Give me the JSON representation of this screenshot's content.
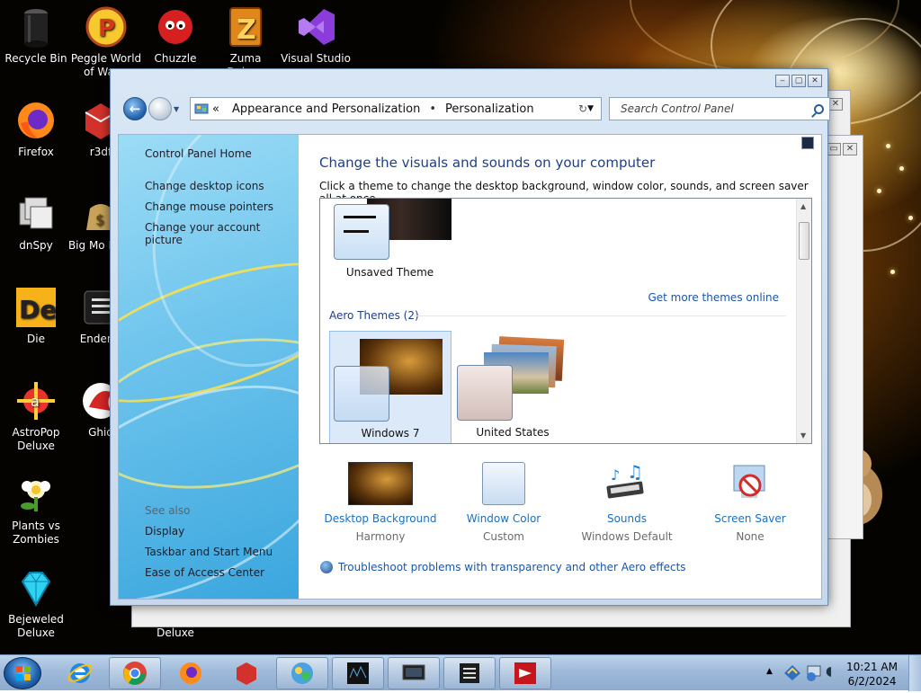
{
  "desktop": {
    "icons": [
      {
        "label": "Recycle Bin",
        "icon": "recycle-bin-icon"
      },
      {
        "label": "Peggle World of Warcr",
        "icon": "peggle-icon"
      },
      {
        "label": "Chuzzle",
        "icon": "chuzzle-icon"
      },
      {
        "label": "Zuma Deluxe",
        "icon": "zuma-icon"
      },
      {
        "label": "Visual Studio",
        "icon": "visual-studio-icon"
      },
      {
        "label": "Firefox",
        "icon": "firefox-icon"
      },
      {
        "label": "r3df",
        "icon": "r3df-icon"
      },
      {
        "label": "dnSpy",
        "icon": "dnspy-icon"
      },
      {
        "label": "Big Mo Delu",
        "icon": "big-money-icon"
      },
      {
        "label": "Die",
        "icon": "die-icon"
      },
      {
        "label": "Enderm",
        "icon": "endermanch-icon"
      },
      {
        "label": "AstroPop Deluxe",
        "icon": "astropop-icon"
      },
      {
        "label": "Ghid",
        "icon": "ghidra-icon"
      },
      {
        "label": "Plants vs Zombies",
        "icon": "pvz-icon"
      },
      {
        "label": "Bejeweled Deluxe",
        "icon": "bejeweled-icon"
      },
      {
        "label": "Deluxe",
        "icon": "deluxe-icon"
      }
    ]
  },
  "window": {
    "breadcrumb": [
      "Appearance and Personalization",
      "Personalization"
    ],
    "search_placeholder": "Search Control Panel",
    "left_pane": {
      "home": "Control Panel Home",
      "links": [
        "Change desktop icons",
        "Change mouse pointers",
        "Change your account picture"
      ],
      "see_also_label": "See also",
      "see_also": [
        "Display",
        "Taskbar and Start Menu",
        "Ease of Access Center"
      ]
    },
    "title": "Change the visuals and sounds on your computer",
    "description": "Click a theme to change the desktop background, window color, sounds, and screen saver all at once.",
    "themes": {
      "unsaved": "Unsaved Theme",
      "get_more": "Get more themes online",
      "aero_header": "Aero Themes (2)",
      "aero": [
        "Windows 7",
        "United States"
      ],
      "selected": "Windows 7"
    },
    "settings": [
      {
        "label": "Desktop Background",
        "value": "Harmony",
        "icon": "desktop-background-icon"
      },
      {
        "label": "Window Color",
        "value": "Custom",
        "icon": "window-color-icon"
      },
      {
        "label": "Sounds",
        "value": "Windows Default",
        "icon": "sounds-icon"
      },
      {
        "label": "Screen Saver",
        "value": "None",
        "icon": "screen-saver-icon"
      }
    ],
    "troubleshoot": "Troubleshoot problems with transparency and other Aero effects"
  },
  "taskbar": {
    "buttons": [
      "internet-explorer-icon",
      "chrome-icon",
      "firefox-icon",
      "r3df-icon",
      "control-panel-icon",
      "dnspy-taskbar-icon",
      "display-icon",
      "console-icon",
      "app-red-icon"
    ],
    "time": "10:21 AM",
    "date": "6/2/2024"
  },
  "colors": {
    "link": "#1c55a8",
    "title": "#1e3f87",
    "taskbar": "#9fbad9"
  }
}
